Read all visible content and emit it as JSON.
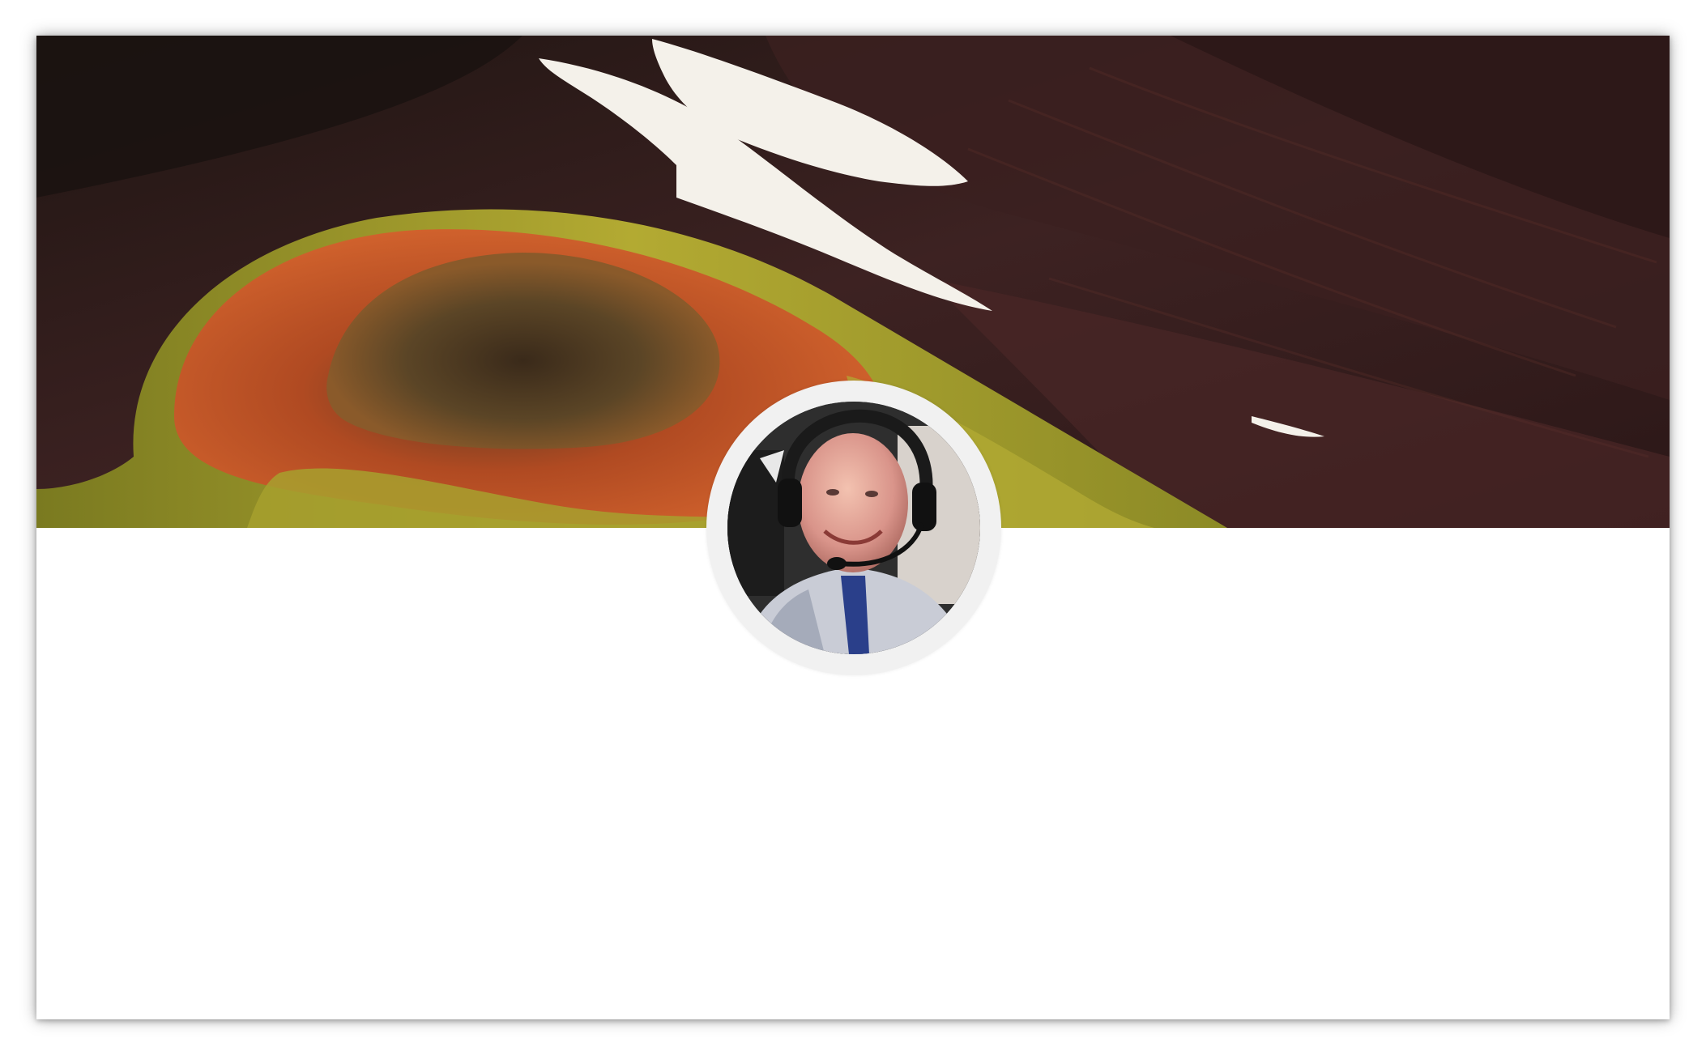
{
  "profile_card": {
    "cover_image": "volcanic-crater-landscape",
    "avatar_image": "pilot-with-headset-portrait"
  },
  "colors": {
    "card_background": "#ffffff",
    "avatar_ring": "#f1f1f1",
    "cover_dark": "#2a1a18",
    "crater_orange": "#c8562a",
    "moss_green": "#a8a030",
    "snow": "#f4f1ea"
  }
}
